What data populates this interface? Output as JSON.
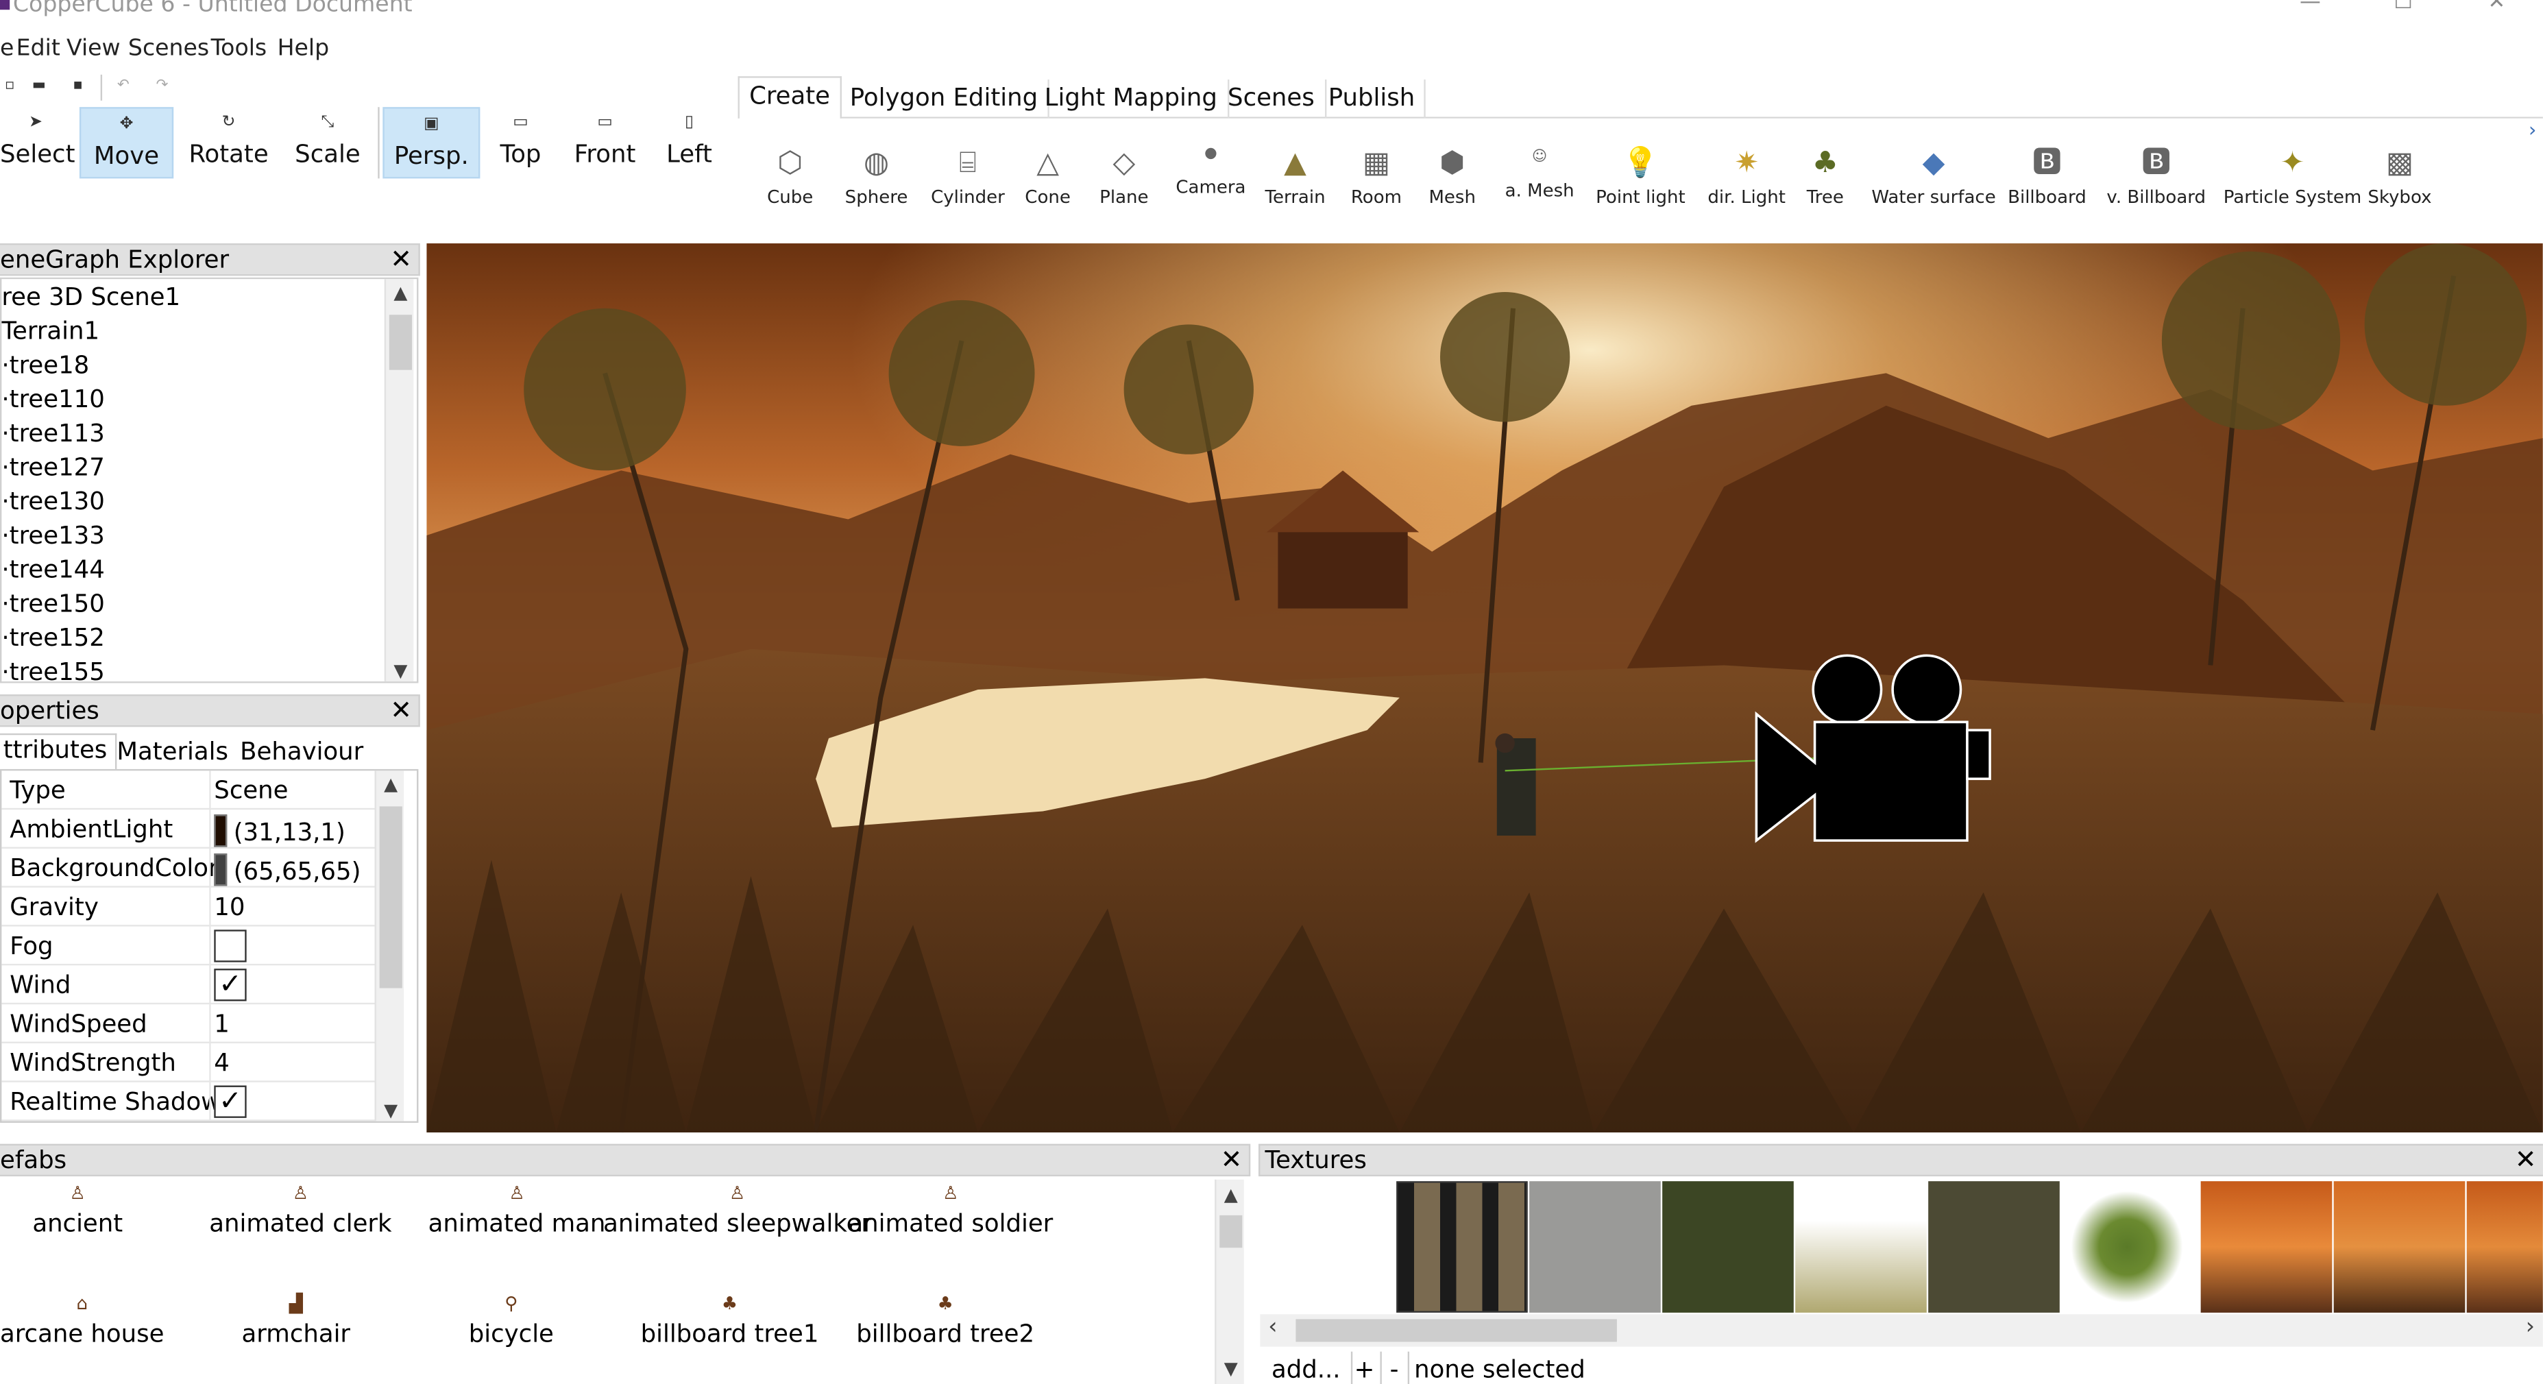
{
  "window": {
    "title": "CopperCube 6 - Untitled Document"
  },
  "menu": [
    "e",
    "Edit",
    "View",
    "Scenes",
    "Tools",
    "Help"
  ],
  "tools": [
    {
      "label": "Select",
      "icon": "cursor-icon"
    },
    {
      "label": "Move",
      "icon": "move-icon",
      "active": true
    },
    {
      "label": "Rotate",
      "icon": "rotate-icon"
    },
    {
      "label": "Scale",
      "icon": "scale-icon"
    },
    {
      "label": "Persp.",
      "icon": "perspective-icon",
      "active": true
    },
    {
      "label": "Top",
      "icon": "top-view-icon"
    },
    {
      "label": "Front",
      "icon": "front-view-icon"
    },
    {
      "label": "Left",
      "icon": "left-view-icon"
    }
  ],
  "create_tabs": [
    "Create",
    "Polygon Editing",
    "Light Mapping",
    "Scenes",
    "Publish"
  ],
  "create_items": [
    "Cube",
    "Sphere",
    "Cylinder",
    "Cone",
    "Plane",
    "Camera",
    "Terrain",
    "Room",
    "Mesh",
    "a. Mesh",
    "Point light",
    "dir. Light",
    "Tree",
    "Water surface",
    "Billboard",
    "v. Billboard",
    "Particle System",
    "Skybox"
  ],
  "scenegraph": {
    "title": "eneGraph Explorer",
    "items": [
      "ree 3D Scene1",
      "Terrain1",
      "tree18",
      "tree110",
      "tree113",
      "tree127",
      "tree130",
      "tree133",
      "tree144",
      "tree150",
      "tree152",
      "tree155"
    ]
  },
  "properties": {
    "title": "operties",
    "tabs": [
      "ttributes",
      "Materials",
      "Behaviour"
    ],
    "rows": [
      {
        "key": "Type",
        "value": "Scene"
      },
      {
        "key": "AmbientLight",
        "value": "(31,13,1)",
        "color": "#1f0d01"
      },
      {
        "key": "BackgroundColor",
        "value": "(65,65,65)",
        "color": "#414141"
      },
      {
        "key": "Gravity",
        "value": "10"
      },
      {
        "key": "Fog",
        "checked": false
      },
      {
        "key": "Wind",
        "checked": true
      },
      {
        "key": "WindSpeed",
        "value": "1"
      },
      {
        "key": "WindStrength",
        "value": "4"
      },
      {
        "key": "Realtime Shadows",
        "checked": true
      }
    ]
  },
  "prefabs": {
    "title": "efabs",
    "items": [
      "ancient",
      "animated clerk",
      "animated man",
      "animated sleepwalker",
      "animated soldier",
      "arcane house",
      "armchair",
      "bicycle",
      "billboard tree1",
      "billboard tree2"
    ]
  },
  "textures": {
    "title": "Textures",
    "add_label": "add...",
    "plus_label": "+",
    "minus_label": "-",
    "status": "none selected"
  }
}
